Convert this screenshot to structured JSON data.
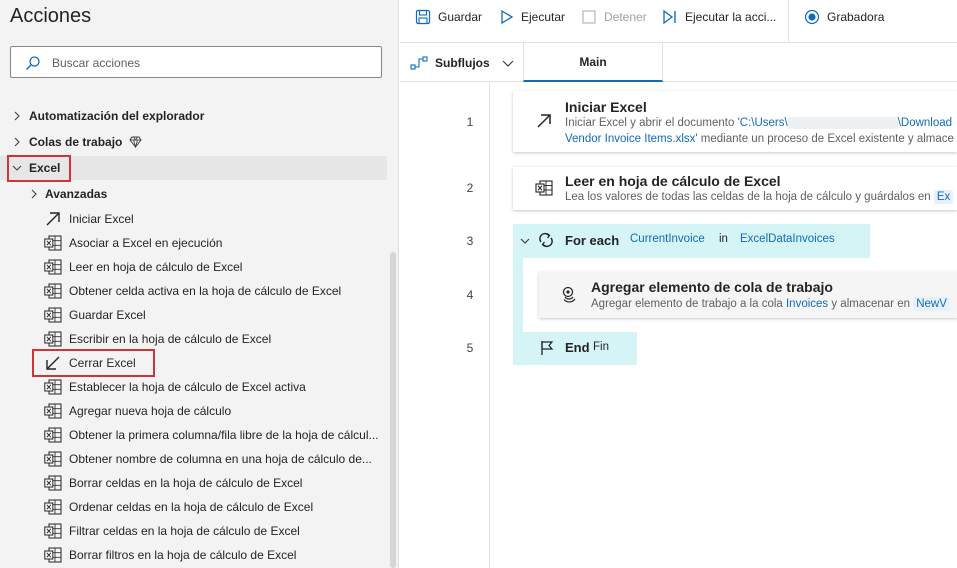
{
  "actions_pane": {
    "title": "Acciones",
    "search_placeholder": "Buscar acciones",
    "groups": [
      {
        "label": "Automatización del explorador"
      },
      {
        "label": "Colas de trabajo"
      },
      {
        "label": "Excel"
      }
    ],
    "subgroup": "Avanzadas",
    "items": [
      {
        "label": "Iniciar Excel",
        "icon": "launch-arrow-icon"
      },
      {
        "label": "Asociar a Excel en ejecución",
        "icon": "excel-icon"
      },
      {
        "label": "Leer en hoja de cálculo de Excel",
        "icon": "excel-icon"
      },
      {
        "label": "Obtener celda activa en la hoja de cálculo de Excel",
        "icon": "excel-icon"
      },
      {
        "label": "Guardar Excel",
        "icon": "excel-icon"
      },
      {
        "label": "Escribir en la hoja de cálculo de Excel",
        "icon": "excel-icon"
      },
      {
        "label": "Cerrar Excel",
        "icon": "close-arrow-icon"
      },
      {
        "label": "Establecer la hoja de cálculo de Excel activa",
        "icon": "excel-icon"
      },
      {
        "label": "Agregar nueva hoja de cálculo",
        "icon": "excel-icon"
      },
      {
        "label": "Obtener la primera columna/fila libre de la hoja de cálcul...",
        "icon": "excel-icon"
      },
      {
        "label": "Obtener nombre de columna en una hoja de cálculo de...",
        "icon": "excel-icon"
      },
      {
        "label": "Borrar celdas en la hoja de cálculo de Excel",
        "icon": "excel-icon"
      },
      {
        "label": "Ordenar celdas en la hoja de cálculo de Excel",
        "icon": "excel-icon"
      },
      {
        "label": "Filtrar celdas en la hoja de cálculo de Excel",
        "icon": "excel-icon"
      },
      {
        "label": "Borrar filtros en la hoja de cálculo de Excel",
        "icon": "excel-icon"
      }
    ]
  },
  "toolbar": {
    "save": "Guardar",
    "run": "Ejecutar",
    "stop": "Detener",
    "run_next": "Ejecutar la acci...",
    "recorder": "Grabadora"
  },
  "tabs": {
    "subflows": "Subflujos",
    "main": "Main"
  },
  "flow": {
    "line_numbers": [
      "1",
      "2",
      "3",
      "4",
      "5"
    ],
    "step1": {
      "title": "Iniciar Excel",
      "desc_a": "Iniciar Excel y abrir el documento ",
      "path_a": "'C:\\Users\\",
      "path_b": "\\Download",
      "path_c": "Vendor Invoice Items.xlsx'",
      "desc_b": " mediante un proceso de Excel existente y almace"
    },
    "step2": {
      "title": "Leer en hoja de cálculo de Excel",
      "desc": "Lea los valores de todas las celdas de la hoja de cálculo y guárdalos en ",
      "var": "Ex"
    },
    "foreach": {
      "keyword": "For each",
      "item_var": "CurrentInvoice",
      "in": "in",
      "list_var": "ExcelDataInvoices"
    },
    "step4": {
      "title": "Agregar elemento de cola de trabajo",
      "desc_a": "Agregar elemento de trabajo a la cola ",
      "queue": "Invoices",
      "desc_b": " y almacenar en ",
      "var": "NewV"
    },
    "end": {
      "keyword": "End",
      "label": "Fin"
    }
  },
  "colors": {
    "accent": "#0f6cbd",
    "highlight_red": "#d13438",
    "loop_bg": "#d4f4f6"
  }
}
